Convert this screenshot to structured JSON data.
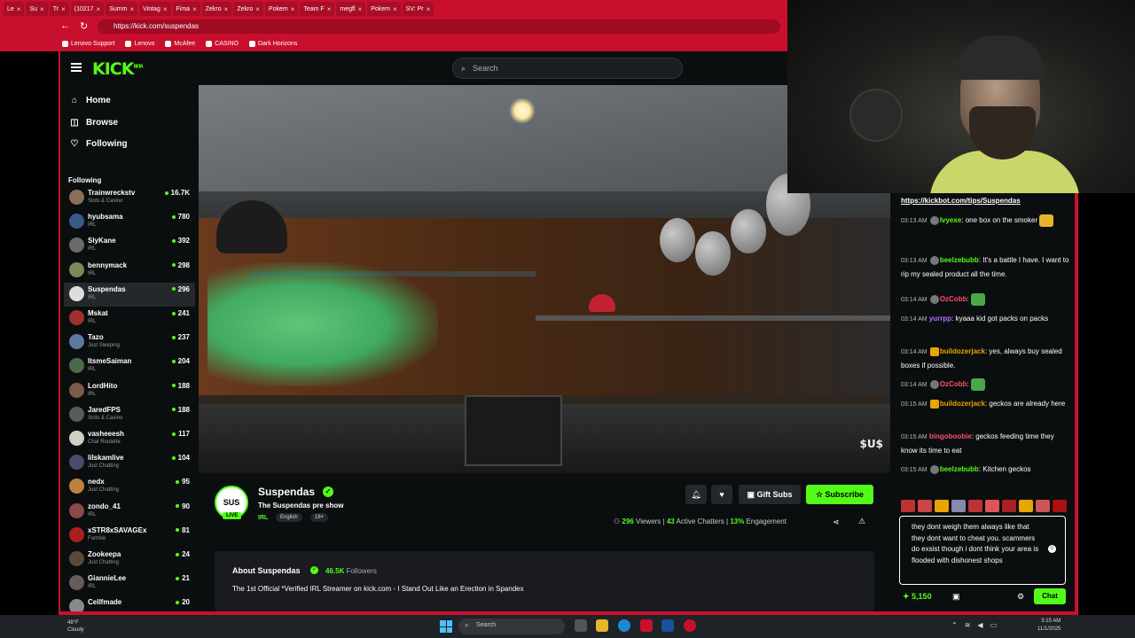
{
  "browser": {
    "tabs": [
      "Le",
      "Su",
      "Tr",
      "(10217",
      "Summ",
      "Vintag",
      "Fima",
      "Zekro",
      "Zekro",
      "Pokem",
      "Team F",
      "megfl",
      "Pokem",
      "SV: Pr"
    ],
    "url": "https://kick.com/suspendas",
    "bookmarks": [
      "Lenovo Support",
      "Lenovo",
      "McAfee",
      "CASINO",
      "Dark Horizons"
    ]
  },
  "kick": {
    "logo": "KICK",
    "logo_beta": "BETA",
    "search_placeholder": "Search",
    "nav": [
      {
        "label": "Home",
        "icon": "home-icon",
        "glyph": "⌂"
      },
      {
        "label": "Browse",
        "icon": "browse-icon",
        "glyph": "◫"
      },
      {
        "label": "Following",
        "icon": "heart-icon",
        "glyph": "♡"
      }
    ],
    "following_heading": "Following",
    "channels": [
      {
        "name": "Trainwreckstv",
        "category": "Slots & Casino",
        "viewers": "16.7K",
        "color": "#8a6d5a"
      },
      {
        "name": "hyubsama",
        "category": "IRL",
        "viewers": "780",
        "color": "#3b5a8a"
      },
      {
        "name": "SlyKane",
        "category": "IRL",
        "viewers": "392",
        "color": "#6a6a6a"
      },
      {
        "name": "bennymack",
        "category": "IRL",
        "viewers": "298",
        "color": "#7a8a5a"
      },
      {
        "name": "Suspendas",
        "category": "IRL",
        "viewers": "296",
        "color": "#dddddd",
        "selected": true
      },
      {
        "name": "Mskat",
        "category": "IRL",
        "viewers": "241",
        "color": "#a03030"
      },
      {
        "name": "Tazo",
        "category": "Just Sleeping",
        "viewers": "237",
        "color": "#5a7aa0"
      },
      {
        "name": "ItsmeSaiman",
        "category": "IRL",
        "viewers": "204",
        "color": "#4a6a4a"
      },
      {
        "name": "LordHito",
        "category": "IRL",
        "viewers": "188",
        "color": "#7a5a4a"
      },
      {
        "name": "JaredFPS",
        "category": "Slots & Casino",
        "viewers": "188",
        "color": "#5a5a5a"
      },
      {
        "name": "vasheeesh",
        "category": "Chat Roulette",
        "viewers": "117",
        "color": "#d0d0c0"
      },
      {
        "name": "lilskamlive",
        "category": "Just Chatting",
        "viewers": "104",
        "color": "#4a4a6a"
      },
      {
        "name": "nedx",
        "category": "Just Chatting",
        "viewers": "95",
        "color": "#c08040"
      },
      {
        "name": "zondo_41",
        "category": "IRL",
        "viewers": "90",
        "color": "#8a4a4a"
      },
      {
        "name": "xSTR8xSAVAGEx",
        "category": "Fortnite",
        "viewers": "81",
        "color": "#aa2020"
      },
      {
        "name": "Zookeepa",
        "category": "Just Chatting",
        "viewers": "24",
        "color": "#5a4a3a"
      },
      {
        "name": "GiannieLee",
        "category": "IRL",
        "viewers": "21",
        "color": "#6a5a5a"
      },
      {
        "name": "Cellfmade",
        "category": "",
        "viewers": "20",
        "color": "#8a8a8a"
      }
    ]
  },
  "stream": {
    "watermark": "$U$",
    "avatar_text": "SUS",
    "live_badge": "LIVE",
    "streamer": "Suspendas",
    "title": "The Suspendas pre show",
    "category": "IRL",
    "tags": [
      "English",
      "18+"
    ],
    "gift_subs": "Gift Subs",
    "subscribe": "Subscribe",
    "viewers_count": "296",
    "viewers_label": "Viewers",
    "chatters_count": "43",
    "chatters_label": "Active Chatters",
    "engagement_count": "13%",
    "engagement_label": "Engagement",
    "about_title": "About Suspendas",
    "followers_count": "46.5K",
    "followers_label": "Followers",
    "about_text": "The 1st Official *Verified IRL Streamer on kick.com - I Stand Out Like an Erection in Spandex"
  },
  "chat": {
    "link": "https://kickbot.com/tips/Suspendas",
    "messages": [
      {
        "time": "03:13 AM",
        "user": "lvyexe",
        "color": "#53fc18",
        "text": ": one box on the smoker",
        "emote": "y",
        "badge": "grey"
      },
      {
        "time": "03:13 AM",
        "user": "beelzebubb",
        "color": "#53fc18",
        "text": ": It's a battle I have. I want to rip my sealed product all the time.",
        "badge": "grey"
      },
      {
        "time": "03:14 AM",
        "user": "OzCobb",
        "color": "#ff4d6d",
        "text": ": ",
        "emote": "g",
        "badge": "grey"
      },
      {
        "time": "03:14 AM",
        "user": "yurrpp",
        "color": "#b66bff",
        "text": ": kyaaa kid got packs on packs"
      },
      {
        "time": "03:14 AM",
        "user": "buildozerjack",
        "color": "#e9a400",
        "text": ": yes, always buy sealed boxes if possible.",
        "badge": "crown"
      },
      {
        "time": "03:14 AM",
        "user": "OzCobb",
        "color": "#ff4d6d",
        "text": ": ",
        "emote": "g",
        "badge": "grey"
      },
      {
        "time": "03:15 AM",
        "user": "buildozerjack",
        "color": "#e9a400",
        "text": ": geckos are already here",
        "badge": "crown"
      },
      {
        "time": "03:15 AM",
        "user": "bingoboobie",
        "color": "#ff4d6d",
        "text": ": geckos feeding time they know its time to eat"
      },
      {
        "time": "03:15 AM",
        "user": "beelzebubb",
        "color": "#53fc18",
        "text": ": Kitchen geckos",
        "badge": "grey"
      }
    ],
    "draft": "they dont weigh them always like that they dont want to cheat you. scammers do exsist though i dont think your area is flooded with dishonest shops",
    "points": "5,150",
    "send": "Chat"
  },
  "taskbar": {
    "temp": "48°F",
    "weather": "Cloudy",
    "search_placeholder": "Search",
    "time": "3:15 AM",
    "date": "11/1/2025"
  }
}
